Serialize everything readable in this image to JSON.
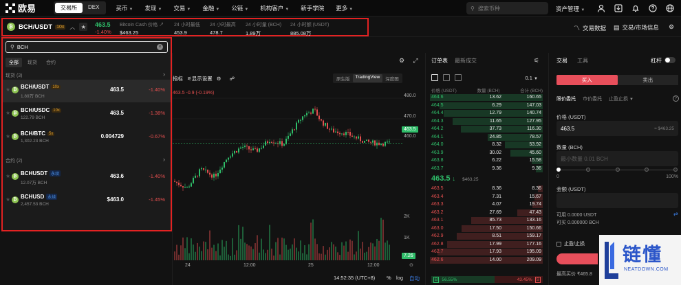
{
  "topnav": {
    "logo_text": "欧易",
    "modes": [
      "交易所",
      "DEX"
    ],
    "items": [
      "买币",
      "发现",
      "交易",
      "金融",
      "公链",
      "机构客户",
      "新手学院",
      "更多"
    ],
    "search_placeholder": "搜索币种",
    "asset_mgmt": "资产管理"
  },
  "ticker": {
    "pair": "BCH/USDT",
    "leverage": "10x",
    "last_price": "463.5",
    "change": "-1.40%",
    "stats": [
      {
        "label": "Bitcoin Cash 价格",
        "value": "$463.25"
      },
      {
        "label": "24 小时最低",
        "value": "453.9"
      },
      {
        "label": "24 小时最高",
        "value": "478.7"
      },
      {
        "label": "24 小时量 (BCH)",
        "value": "1.89万"
      },
      {
        "label": "24 小时额 (USDT)",
        "value": "885.08万"
      }
    ],
    "right_links": [
      "交易数据",
      "交易/市场信息"
    ]
  },
  "dropdown": {
    "query": "BCH",
    "tabs": [
      "全部",
      "现货",
      "合约"
    ],
    "sections": [
      {
        "title": "现货 (3)",
        "rows": [
          {
            "name": "BCH/USDT",
            "tag": "10x",
            "tag_type": "lever",
            "vol": "1.89万 BCH",
            "price": "463.5",
            "change": "-1.40%",
            "dir": "down"
          },
          {
            "name": "BCH/USDC",
            "tag": "10x",
            "tag_type": "lever",
            "vol": "122.79 BCH",
            "price": "463.5",
            "change": "-1.38%",
            "dir": "down"
          },
          {
            "name": "BCH/BTC",
            "tag": "5x",
            "tag_type": "lever",
            "vol": "1,302.23 BCH",
            "price": "0.004729",
            "change": "-0.67%",
            "dir": "down"
          }
        ]
      },
      {
        "title": "合约 (2)",
        "rows": [
          {
            "name": "BCHUSDT",
            "tag": "永续",
            "tag_type": "perp",
            "vol": "12.07万 BCH",
            "price": "463.6",
            "change": "-1.40%",
            "dir": "down"
          },
          {
            "name": "BCHUSD",
            "tag": "永续",
            "tag_type": "perp",
            "vol": "2,457.53 BCH",
            "price": "$463.0",
            "change": "-1.45%",
            "dir": "down"
          }
        ]
      }
    ]
  },
  "chart": {
    "toolbar": [
      "指标",
      "显示设置"
    ],
    "views": [
      "原生版",
      "TradingView",
      "深度图"
    ],
    "ohlc_tail": "463.5",
    "ohlc_change": "-0.9 (-0.19%)",
    "price_ticks": [
      "480.0",
      "470.0",
      "460.0"
    ],
    "last_tag": "463.5",
    "vol_ticks": [
      "2K",
      "1K"
    ],
    "vol_tag": "7.26",
    "date_ticks": [
      "24",
      "12:00",
      "25",
      "12:00"
    ],
    "clock": "14:52:35 (UTC+8)",
    "pct": "%",
    "log": "log",
    "auto": "自动",
    "colors": {
      "up": "#2fbd69",
      "down": "#e34f4f"
    }
  },
  "orderbook": {
    "tabs": [
      "订单表",
      "最新成交"
    ],
    "step": "0.1",
    "columns": [
      "价格 (USDT)",
      "数量 (BCH)",
      "合计 (BCH)"
    ],
    "asks": [
      [
        "464.6",
        "13.62",
        "160.65"
      ],
      [
        "464.5",
        "6.29",
        "147.03"
      ],
      [
        "464.4",
        "12.79",
        "140.74"
      ],
      [
        "464.3",
        "11.65",
        "127.95"
      ],
      [
        "464.2",
        "37.73",
        "116.30"
      ],
      [
        "464.1",
        "24.85",
        "78.57"
      ],
      [
        "464.0",
        "8.32",
        "53.92"
      ],
      [
        "463.9",
        "30.02",
        "45.60"
      ],
      [
        "463.8",
        "6.22",
        "15.58"
      ],
      [
        "463.7",
        "9.36",
        "9.36"
      ]
    ],
    "mid_price": "463.5",
    "mid_arrow": "↓",
    "mid_ref": "$463.25",
    "bids": [
      [
        "463.5",
        "8.36",
        "8.36"
      ],
      [
        "463.4",
        "7.31",
        "15.67"
      ],
      [
        "463.3",
        "4.07",
        "19.74"
      ],
      [
        "463.2",
        "27.69",
        "47.43"
      ],
      [
        "463.1",
        "85.73",
        "133.16"
      ],
      [
        "463.0",
        "17.50",
        "150.66"
      ],
      [
        "462.9",
        "8.51",
        "159.17"
      ],
      [
        "462.8",
        "17.99",
        "177.16"
      ],
      [
        "462.7",
        "17.93",
        "195.09"
      ],
      [
        "462.6",
        "14.00",
        "209.09"
      ]
    ],
    "buy_pct": "56.55%",
    "sell_pct": "43.45%",
    "buy_label": "B",
    "sell_label": "S"
  },
  "trade": {
    "tabs": [
      "交易",
      "工具"
    ],
    "lever_label": "杠杆",
    "buy": "买入",
    "sell": "卖出",
    "order_types": [
      "限价委托",
      "市价委托",
      "止盈止损"
    ],
    "price_label": "价格 (USDT)",
    "price_value": "463.5",
    "price_suffix": "≈ $463.25",
    "qty_label": "数量 (BCH)",
    "qty_placeholder": "最小数量 0.01 BCH",
    "slider_min": "0",
    "slider_max": "100%",
    "amount_label": "金额 (USDT)",
    "avail_usdt": "可用 0.0000 USDT",
    "avail_bch": "可买 0.000000 BCH",
    "tp_label": "止盈/止损",
    "max_buy": "最高买价 ₹465.8"
  },
  "watermark": {
    "big": "链懂",
    "small": "NEATDOWN.COM"
  }
}
